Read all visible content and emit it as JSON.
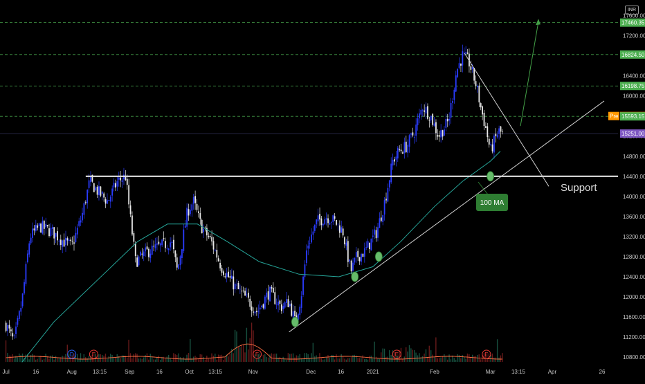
{
  "currency": "INR",
  "chart_data": {
    "type": "candlestick",
    "y_axis": {
      "range": [
        10650,
        17800
      ],
      "ticks": [
        10800,
        11200,
        11600,
        12000,
        12400,
        12800,
        13200,
        13600,
        14000,
        14400,
        14800,
        15200,
        15600,
        16000,
        16400,
        16800,
        17200,
        17600
      ],
      "tick_labels": [
        "10800.00",
        "11200.00",
        "11600.00",
        "12000.00",
        "12400.00",
        "12800.00",
        "13200.00",
        "13600.00",
        "14000.00",
        "14400.00",
        "14800.00",
        "15200.00",
        "15600.00",
        "16000.00",
        "16400.00",
        "16800.00",
        "17200.00",
        "17600.00"
      ]
    },
    "x_axis": {
      "ticks": [
        {
          "label": "Jul",
          "date": "2020-07-01"
        },
        {
          "label": "16",
          "date": "2020-07-16"
        },
        {
          "label": "Aug",
          "date": "2020-08-03"
        },
        {
          "label": "13:15",
          "date": "2020-08-17"
        },
        {
          "label": "Sep",
          "date": "2020-09-01"
        },
        {
          "label": "16",
          "date": "2020-09-16"
        },
        {
          "label": "Oct",
          "date": "2020-10-01"
        },
        {
          "label": "13:15",
          "date": "2020-10-14"
        },
        {
          "label": "Nov",
          "date": "2020-11-02"
        },
        {
          "label": "Dec",
          "date": "2020-12-01"
        },
        {
          "label": "16",
          "date": "2020-12-16"
        },
        {
          "label": "2021",
          "date": "2021-01-01"
        },
        {
          "label": "Feb",
          "date": "2021-02-01"
        },
        {
          "label": "Mar",
          "date": "2021-03-01"
        },
        {
          "label": "13:15",
          "date": "2021-03-15"
        },
        {
          "label": "Apr",
          "date": "2021-04-01"
        },
        {
          "label": "26",
          "date": "2021-04-26"
        }
      ]
    },
    "price_path": [
      [
        "2020-07-01",
        11450
      ],
      [
        "2020-07-05",
        11100
      ],
      [
        "2020-07-09",
        11900
      ],
      [
        "2020-07-13",
        13200
      ],
      [
        "2020-07-18",
        13400
      ],
      [
        "2020-07-24",
        13300
      ],
      [
        "2020-07-30",
        13100
      ],
      [
        "2020-08-03",
        13000
      ],
      [
        "2020-08-08",
        13600
      ],
      [
        "2020-08-12",
        14300
      ],
      [
        "2020-08-16",
        14100
      ],
      [
        "2020-08-21",
        13900
      ],
      [
        "2020-08-26",
        14300
      ],
      [
        "2020-08-30",
        14400
      ],
      [
        "2020-09-01",
        13700
      ],
      [
        "2020-09-04",
        12700
      ],
      [
        "2020-09-10",
        12900
      ],
      [
        "2020-09-16",
        13000
      ],
      [
        "2020-09-22",
        13100
      ],
      [
        "2020-09-25",
        12500
      ],
      [
        "2020-09-30",
        13700
      ],
      [
        "2020-10-03",
        13900
      ],
      [
        "2020-10-07",
        13400
      ],
      [
        "2020-10-12",
        13100
      ],
      [
        "2020-10-17",
        12600
      ],
      [
        "2020-10-24",
        12200
      ],
      [
        "2020-10-31",
        11900
      ],
      [
        "2020-11-04",
        11700
      ],
      [
        "2020-11-10",
        12100
      ],
      [
        "2020-11-16",
        11800
      ],
      [
        "2020-11-20",
        11900
      ],
      [
        "2020-11-23",
        11500
      ],
      [
        "2020-11-26",
        12000
      ],
      [
        "2020-11-29",
        13000
      ],
      [
        "2020-12-04",
        13500
      ],
      [
        "2020-12-09",
        13600
      ],
      [
        "2020-12-13",
        13500
      ],
      [
        "2020-12-17",
        13300
      ],
      [
        "2020-12-21",
        12500
      ],
      [
        "2020-12-24",
        12800
      ],
      [
        "2020-12-28",
        12900
      ],
      [
        "2021-01-03",
        13300
      ],
      [
        "2021-01-07",
        13900
      ],
      [
        "2021-01-11",
        14700
      ],
      [
        "2021-01-14",
        14900
      ],
      [
        "2021-01-18",
        15000
      ],
      [
        "2021-01-22",
        15300
      ],
      [
        "2021-01-26",
        15800
      ],
      [
        "2021-01-30",
        15600
      ],
      [
        "2021-02-03",
        15200
      ],
      [
        "2021-02-08",
        15500
      ],
      [
        "2021-02-12",
        16500
      ],
      [
        "2021-02-15",
        16800
      ],
      [
        "2021-02-18",
        16700
      ],
      [
        "2021-02-22",
        16200
      ],
      [
        "2021-02-24",
        15800
      ],
      [
        "2021-02-27",
        15300
      ],
      [
        "2021-03-01",
        14900
      ],
      [
        "2021-03-03",
        15100
      ],
      [
        "2021-03-05",
        15300
      ],
      [
        "2021-03-07",
        15250
      ]
    ],
    "annotations": {
      "horizontal_lines": [
        17460.35,
        16824.5,
        16198.75,
        15593.15
      ],
      "support_level": 14400,
      "labels": {
        "support": "Support",
        "ma": "100 MA"
      },
      "price_tags": [
        {
          "value": 17460.35,
          "label": "17460.35",
          "color": "#4caf50"
        },
        {
          "value": 16824.5,
          "label": "16824.50",
          "color": "#4caf50"
        },
        {
          "value": 16198.75,
          "label": "16198.75",
          "color": "#4caf50"
        },
        {
          "value": 15600,
          "label": "15600.00",
          "color": "#ff9800",
          "prefix": "Pre"
        },
        {
          "value": 15593.15,
          "label": "15593.15",
          "color": "#4caf50"
        },
        {
          "value": 15251,
          "label": "15251.00",
          "color": "#7e57c2"
        }
      ],
      "event_markers": [
        {
          "letter": "D",
          "date": "2020-08-03",
          "color": "#2962ff"
        },
        {
          "letter": "E",
          "date": "2020-08-14",
          "color": "#e53935"
        },
        {
          "letter": "E",
          "date": "2020-11-04",
          "color": "#e53935"
        },
        {
          "letter": "E",
          "date": "2021-01-13",
          "color": "#e53935"
        },
        {
          "letter": "E",
          "date": "2021-02-27",
          "color": "#e53935"
        }
      ]
    }
  }
}
